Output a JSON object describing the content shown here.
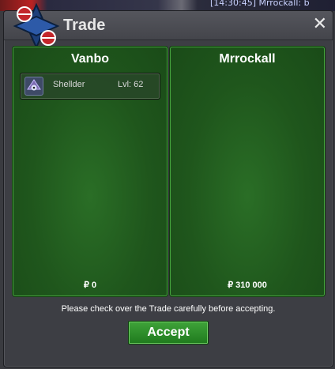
{
  "background": {
    "chat_text": "[14:30:45] Mrrockall: b"
  },
  "window": {
    "title": "Trade",
    "close_glyph": "✕"
  },
  "panels": {
    "left": {
      "name": "Vanbo",
      "money": "₽ 0",
      "items": [
        {
          "name": "Shellder",
          "level": "Lvl: 62",
          "icon": "shellder-icon"
        }
      ]
    },
    "right": {
      "name": "Mrrockall",
      "money": "₽ 310 000",
      "items": []
    }
  },
  "notice": "Please check over the Trade carefully before accepting.",
  "accept_label": "Accept",
  "colors": {
    "panel_green": "#1f561c",
    "accept_green": "#2e8f2b",
    "window_gray": "#3d3e44"
  }
}
